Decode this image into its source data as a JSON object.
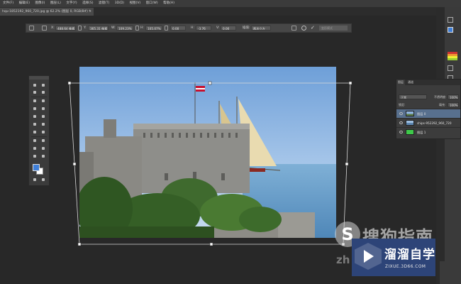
{
  "menubar": {
    "items": [
      "文件(F)",
      "编辑(E)",
      "图像(I)",
      "图层(L)",
      "文字(Y)",
      "选择(S)",
      "滤镜(T)",
      "3D(D)",
      "视图(V)",
      "窗口(W)",
      "帮助(H)"
    ]
  },
  "document": {
    "tab_title": "hqu-1852192_960_720.jpg @ 62.2% (图层 0, RGB/8#) *",
    "close_glyph": "×"
  },
  "options_bar": {
    "x_label": "X:",
    "x_value": "488.64 像素",
    "y_label": "Y:",
    "y_value": "365.31 像素",
    "w_label": "W:",
    "w_value": "109.23%",
    "h_label": "H:",
    "h_value": "105.07%",
    "angle_value": "0.00",
    "h_skew_label": "H:",
    "h_skew_value": "-3.76",
    "v_skew_label": "V:",
    "v_skew_value": "0.00",
    "interp_label": "插值:",
    "interp_value": "两次立方",
    "mode_button": "变形模式"
  },
  "layers_panel": {
    "tabs": [
      "图层",
      "通道"
    ],
    "kind_value": "正常",
    "opacity_label": "不透明度:",
    "opacity_value": "100%",
    "lock_label": "锁定:",
    "fill_label": "填充:",
    "fill_value": "100%",
    "layers": [
      {
        "name": "图层 0",
        "selected": true,
        "thumb": "photo"
      },
      {
        "name": "ships-952292_960_720",
        "selected": false,
        "thumb": "photo"
      },
      {
        "name": "图层 1",
        "selected": false,
        "thumb": "green"
      }
    ]
  },
  "colors": {
    "foreground": "#3f7fd8",
    "background": "#ffffff",
    "layer_1_fill": "#3ec94a",
    "selected_layer": "#58708e"
  },
  "tools": [
    "move-icon",
    "marquee-icon",
    "lasso-icon",
    "quick-select-icon",
    "crop-icon",
    "eyedropper-icon",
    "healing-icon",
    "brush-icon",
    "clone-stamp-icon",
    "history-brush-icon",
    "eraser-icon",
    "gradient-icon",
    "blur-icon",
    "dodge-icon",
    "pen-icon",
    "type-icon",
    "path-select-icon",
    "shape-icon",
    "hand-icon",
    "zoom-icon"
  ],
  "watermarks": {
    "sogou_text": "搜狗指南",
    "sogou_sub": "zh",
    "brand_title": "溜溜自学",
    "brand_url": "ZIXUE.3D66.COM"
  }
}
